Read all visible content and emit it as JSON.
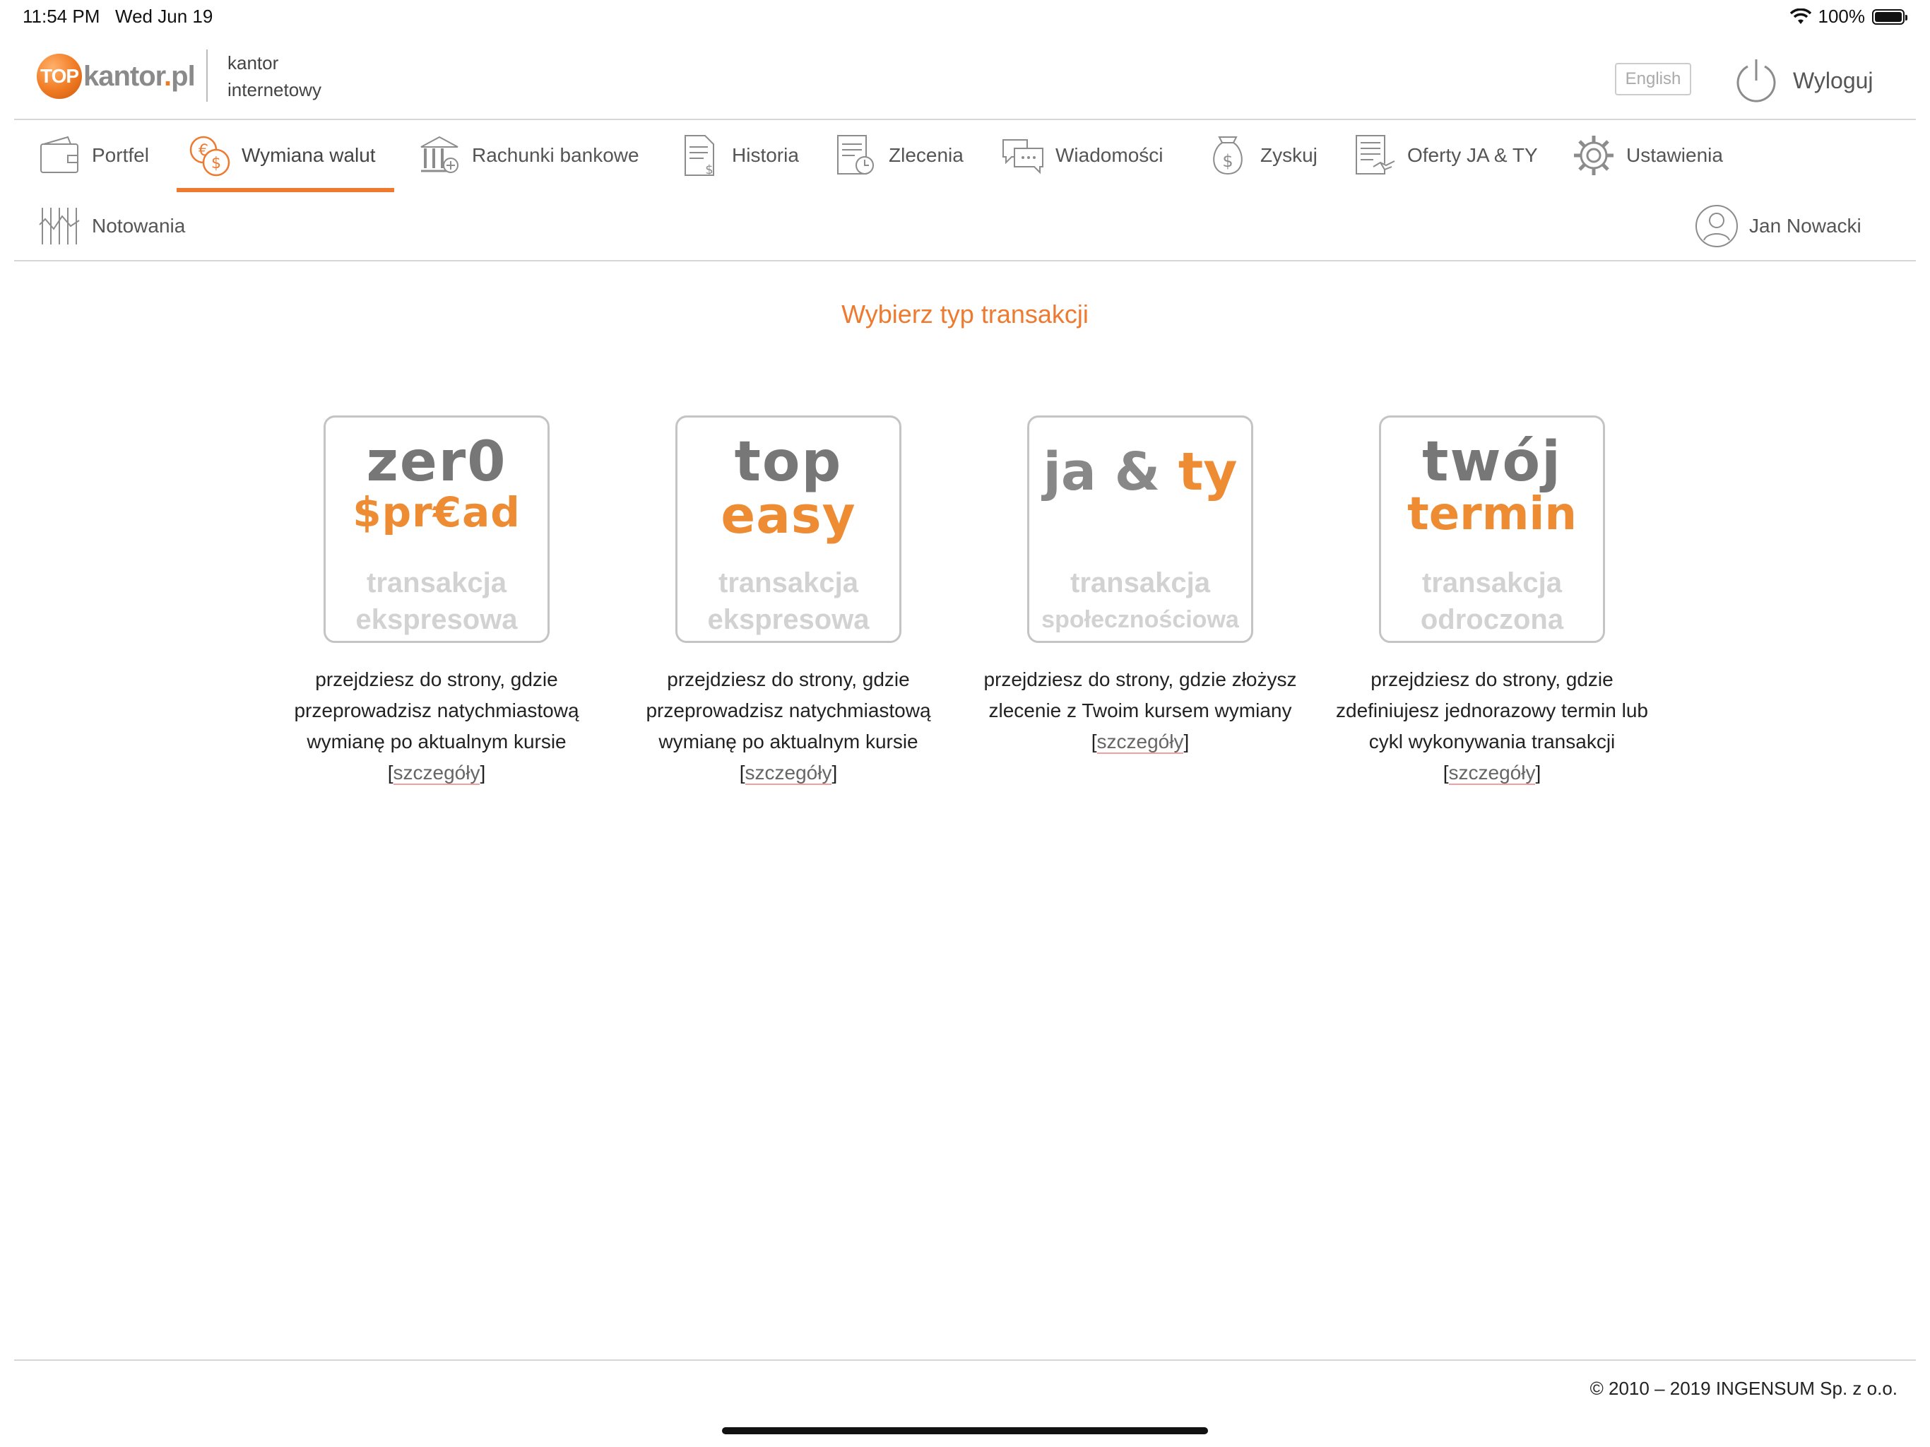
{
  "status_bar": {
    "time": "11:54 PM",
    "date": "Wed Jun 19",
    "battery": "100%"
  },
  "header": {
    "logo_ball": "TOP",
    "logo_text_main": "kantor",
    "logo_text_dot": ".",
    "logo_text_tld": "pl",
    "subtitle_line1": "kantor",
    "subtitle_line2": "internetowy",
    "language_button": "English",
    "logout_label": "Wyloguj"
  },
  "nav": {
    "items": [
      {
        "label": "Portfel",
        "icon": "wallet-icon"
      },
      {
        "label": "Wymiana walut",
        "icon": "currency-exchange-icon",
        "active": true
      },
      {
        "label": "Rachunki bankowe",
        "icon": "bank-icon"
      },
      {
        "label": "Historia",
        "icon": "history-document-icon"
      },
      {
        "label": "Zlecenia",
        "icon": "orders-clock-icon"
      },
      {
        "label": "Wiadomości",
        "icon": "messages-icon"
      },
      {
        "label": "Zyskuj",
        "icon": "money-bag-icon"
      },
      {
        "label": "Oferty JA & TY",
        "icon": "offers-handshake-icon"
      },
      {
        "label": "Ustawienia",
        "icon": "gear-icon"
      },
      {
        "label": "Notowania",
        "icon": "quotes-chart-icon"
      }
    ],
    "user_name": "Jan Nowacki"
  },
  "main": {
    "title": "Wybierz typ transakcji",
    "cards": [
      {
        "tile_line1": "zer0",
        "tile_line2": "$pr€ad",
        "tile_sub1": "transakcja",
        "tile_sub2": "ekspresowa",
        "description": "przejdziesz do strony, gdzie przeprowadzisz natychmiastową wymianę po aktualnym kursie",
        "details": "szczegóły"
      },
      {
        "tile_line1": "top",
        "tile_line2": "easy",
        "tile_sub1": "transakcja",
        "tile_sub2": "ekspresowa",
        "description": "przejdziesz do strony, gdzie przeprowadzisz natychmiastową wymianę po aktualnym kursie",
        "details": "szczegóły"
      },
      {
        "tile_line1": "ja &",
        "tile_line2": "ty",
        "tile_sub1": "transakcja",
        "tile_sub2": "społecznościowa",
        "description": "przejdziesz do strony, gdzie złożysz zlecenie z Twoim kursem wymiany",
        "details": "szczegóły"
      },
      {
        "tile_line1": "twój",
        "tile_line2": "termin",
        "tile_sub1": "transakcja",
        "tile_sub2": "odroczona",
        "description": "przejdziesz do strony, gdzie zdefiniujesz jednorazowy termin lub cykl wykonywania transakcji",
        "details": "szczegóły"
      }
    ]
  },
  "footer": {
    "copyright": "© 2010 – 2019 INGENSUM Sp. z o.o."
  },
  "colors": {
    "accent": "#ee7a2f",
    "divider": "#d6d6d6",
    "icon_gray": "#8c8c8c"
  }
}
